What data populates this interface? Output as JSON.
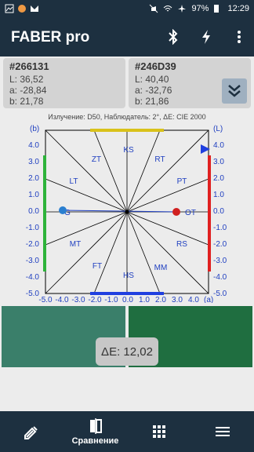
{
  "status_bar": {
    "battery": "97%",
    "time": "12:29"
  },
  "app": {
    "title": "FABER pro"
  },
  "colors": {
    "bar": "#1d3040",
    "card": "#d3d3d3",
    "swatch_left": "#3a7f6a",
    "swatch_right": "#1f6e40",
    "axis": "#1f3fc0"
  },
  "sample1": {
    "hex": "#266131",
    "L": "L: 36,52",
    "a": "a: -28,84",
    "b": "b: 21,78"
  },
  "sample2": {
    "hex": "#246D39",
    "L": "L: 40,40",
    "a": "a: -32,76",
    "b": "b: 21,86"
  },
  "caption": "Излучение: D50, Наблюдатель: 2°, ΔE: CIE 2000",
  "chart": {
    "left_axis_label": "(b)",
    "right_axis_label": "(L)",
    "x_axis_label": "(a)",
    "y_ticks": [
      "4.0",
      "3.0",
      "2.0",
      "1.0",
      "0.0",
      "-1.0",
      "-2.0",
      "-3.0",
      "-4.0",
      "-5.0"
    ],
    "x_ticks": [
      "-5.0",
      "-4.0",
      "-3.0",
      "-2.0",
      "-1.0",
      "0.0",
      "1.0",
      "2.0",
      "3.0",
      "4.0"
    ],
    "region_labels": [
      "KS",
      "ZT",
      "RT",
      "LT",
      "PT",
      "G",
      "OT",
      "MT",
      "RS",
      "FT",
      "MM",
      "HS"
    ]
  },
  "delta_e": "ΔE: 12,02",
  "nav": {
    "compare_label": "Сравнение"
  }
}
